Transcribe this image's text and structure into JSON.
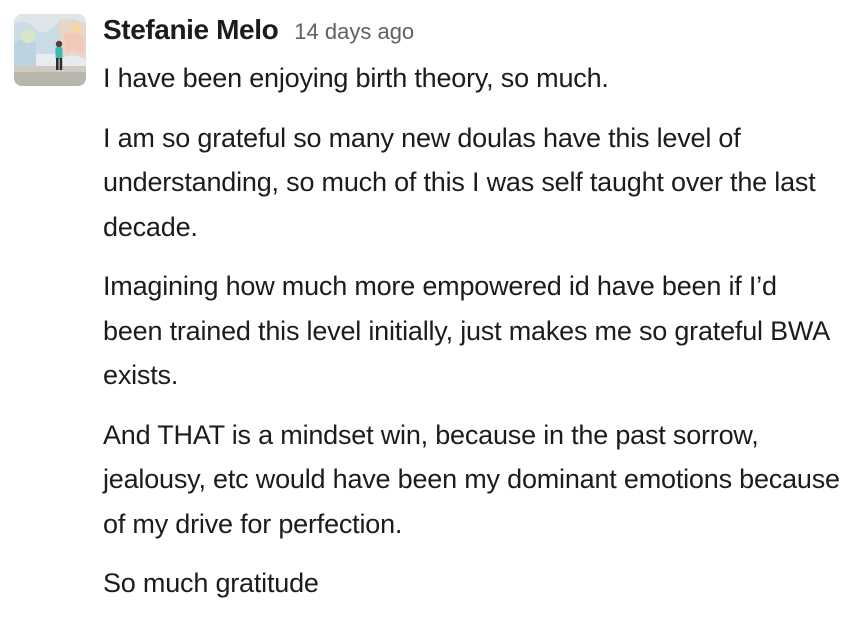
{
  "message": {
    "author": "Stefanie Melo",
    "timestamp": "14 days ago",
    "avatar_icon": "user-photo-avatar",
    "paragraphs": [
      "I have been enjoying birth theory, so much.",
      "I am so grateful so many new doulas have this level of understanding, so much of this I was self taught over the last decade.",
      "Imagining how much more empowered id have been if I’d been trained this level initially, just makes me so grateful BWA exists.",
      "And THAT is a mindset win, because in the past sorrow, jealousy, etc would have been my dominant emotions because of my drive for perfection.",
      "So much gratitude"
    ]
  }
}
